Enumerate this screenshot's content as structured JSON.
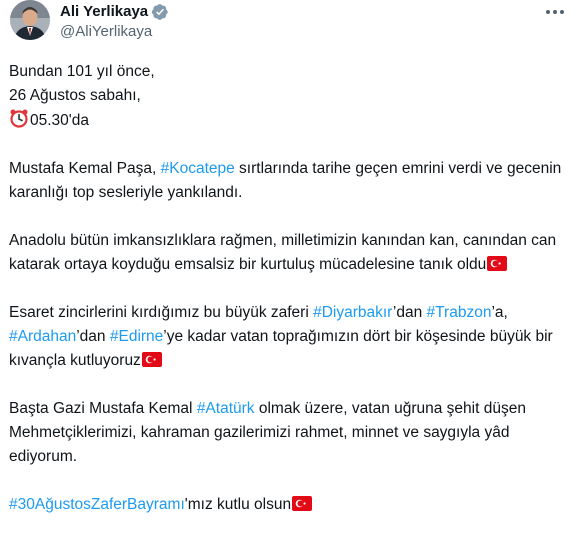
{
  "author": {
    "display_name": "Ali Yerlikaya",
    "handle": "@AliYerlikaya",
    "verified_icon": "verified-badge-icon",
    "more_icon": "more-options-icon"
  },
  "colors": {
    "hashtag": "#1d9bf0",
    "text": "#0f1419",
    "muted": "#536471",
    "flag_red": "#e30a17"
  },
  "tweet": {
    "p1_line1": "Bundan 101 yıl önce,",
    "p1_line2": "26 Ağustos sabahı,",
    "p1_line3_icon": "alarm-clock-icon",
    "p1_line3": "05.30'da",
    "p2_text1": "Mustafa Kemal Paşa, ",
    "p2_hashtag": "#Kocatepe",
    "p2_text2": " sırtlarında tarihe geçen emrini verdi ve gecenin karanlığı top sesleriyle yankılandı.",
    "p3_text": "Anadolu bütün imkansızlıklara rağmen, milletimizin kanından kan, canından can katarak ortaya koyduğu emsalsiz bir kurtuluş mücadelesine tanık oldu",
    "p4_text1": "Esaret zincirlerini kırdığımız bu büyük zaferi ",
    "p4_hashtag1": "#Diyarbakır",
    "p4_text2": "’dan ",
    "p4_hashtag2": "#Trabzon",
    "p4_text3": "’a, ",
    "p4_hashtag3": "#Ardahan",
    "p4_text4": "’dan ",
    "p4_hashtag4": "#Edirne",
    "p4_text5": "’ye kadar vatan toprağımızın dört bir köşesinde büyük bir kıvançla kutluyoruz",
    "p5_text1": "Başta Gazi Mustafa Kemal ",
    "p5_hashtag": "#Atatürk",
    "p5_text2": " olmak üzere, vatan uğruna şehit düşen Mehmetçiklerimizi, kahraman gazilerimizi rahmet, minnet ve saygıyla yâd ediyorum.",
    "p6_hashtag": "#30AğustosZaferBayramı",
    "p6_text": "'mız kutlu olsun",
    "flag_icon": "turkey-flag-icon"
  }
}
